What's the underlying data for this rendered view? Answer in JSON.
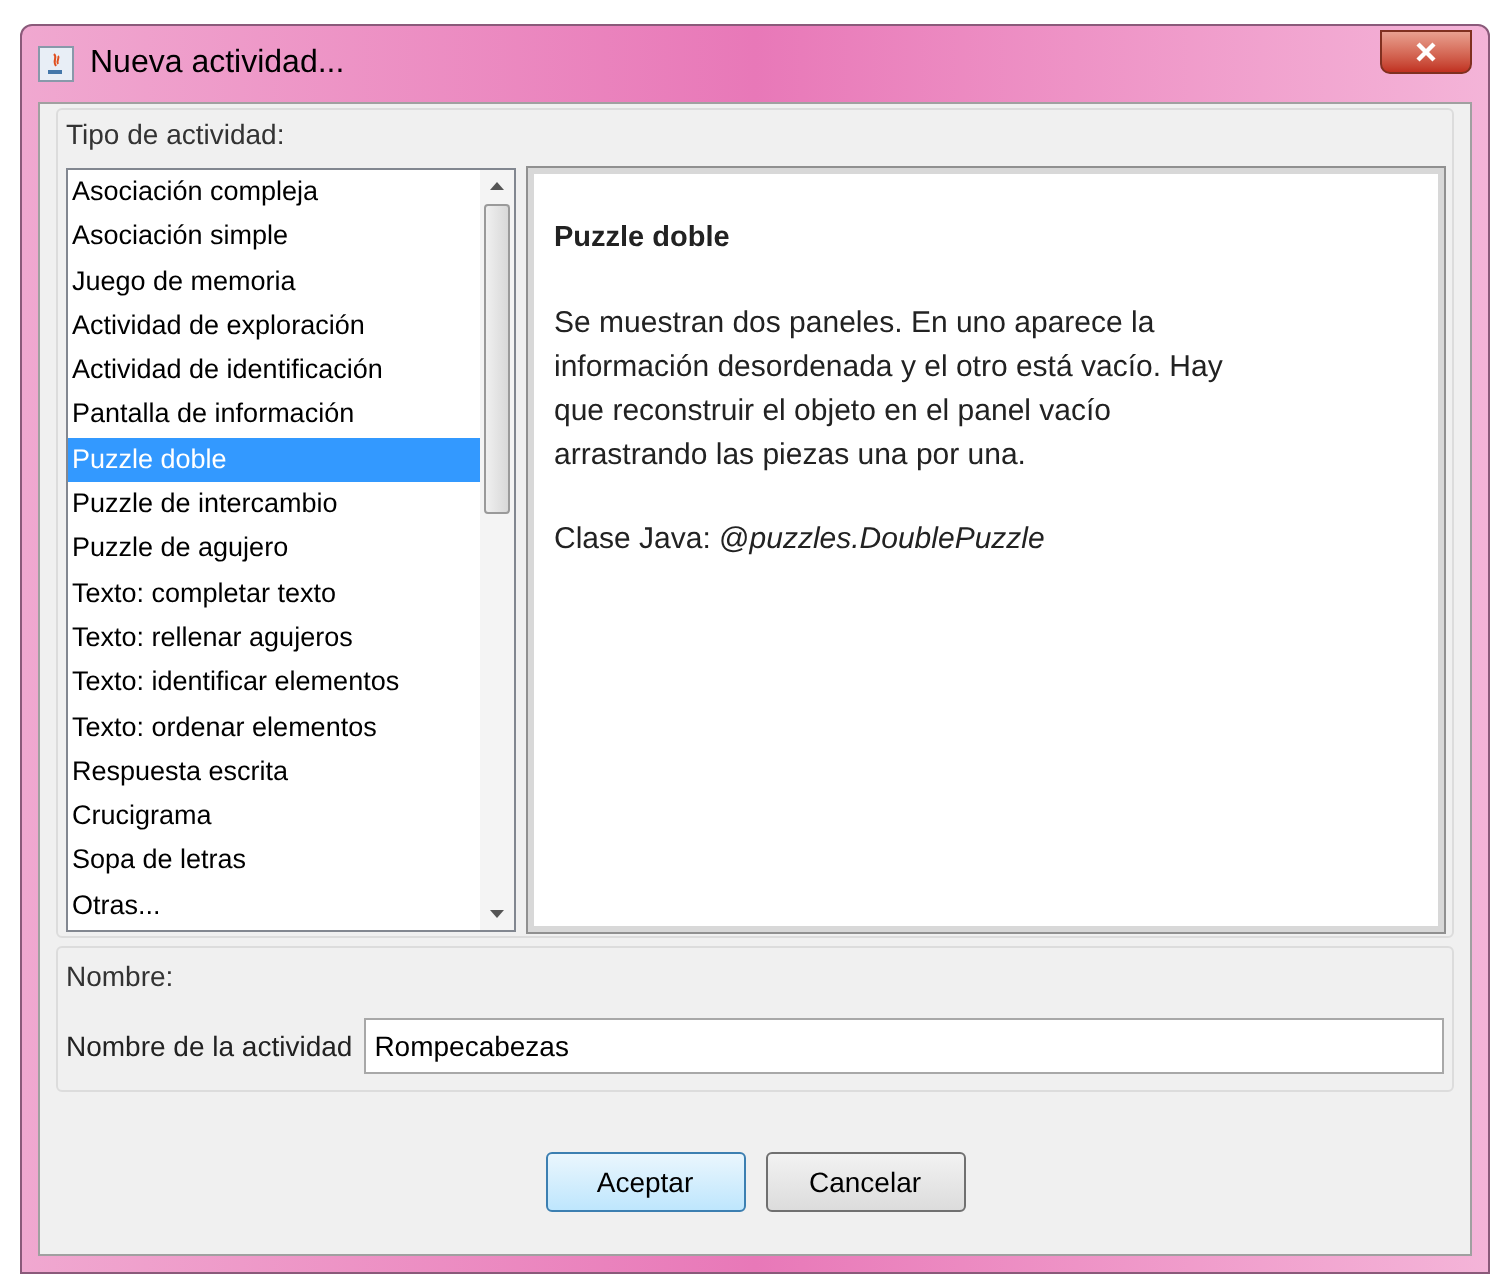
{
  "window": {
    "title": "Nueva actividad..."
  },
  "activity_type": {
    "legend": "Tipo de actividad:",
    "items": [
      {
        "label": "Asociación compleja",
        "selected": false
      },
      {
        "label": "Asociación simple",
        "selected": false
      },
      {
        "label": "Juego de memoria",
        "selected": false
      },
      {
        "label": "Actividad de exploración",
        "selected": false
      },
      {
        "label": "Actividad de identificación",
        "selected": false
      },
      {
        "label": "Pantalla de información",
        "selected": false
      },
      {
        "label": "Puzzle doble",
        "selected": true
      },
      {
        "label": "Puzzle de intercambio",
        "selected": false
      },
      {
        "label": "Puzzle de agujero",
        "selected": false
      },
      {
        "label": "Texto: completar texto",
        "selected": false
      },
      {
        "label": "Texto: rellenar agujeros",
        "selected": false
      },
      {
        "label": "Texto: identificar elementos",
        "selected": false
      },
      {
        "label": "Texto: ordenar elementos",
        "selected": false
      },
      {
        "label": "Respuesta escrita",
        "selected": false
      },
      {
        "label": "Crucigrama",
        "selected": false
      },
      {
        "label": "Sopa de letras",
        "selected": false
      },
      {
        "label": "Otras...",
        "selected": false
      }
    ],
    "description": {
      "title": "Puzzle doble",
      "text": "Se muestran dos paneles. En uno aparece la información desordenada y el otro está vacío. Hay que reconstruir el objeto en el panel vacío arrastrando las piezas una por una.",
      "class": "Clase Java: @*puzzles.DoublePuzzle*"
    }
  },
  "name_group": {
    "legend": "Nombre:",
    "label": "Nombre de la actividad",
    "value": "Rompecabezas"
  },
  "buttons": [
    {
      "label": "Aceptar",
      "default": true
    },
    {
      "label": "Cancelar",
      "default": false
    }
  ]
}
